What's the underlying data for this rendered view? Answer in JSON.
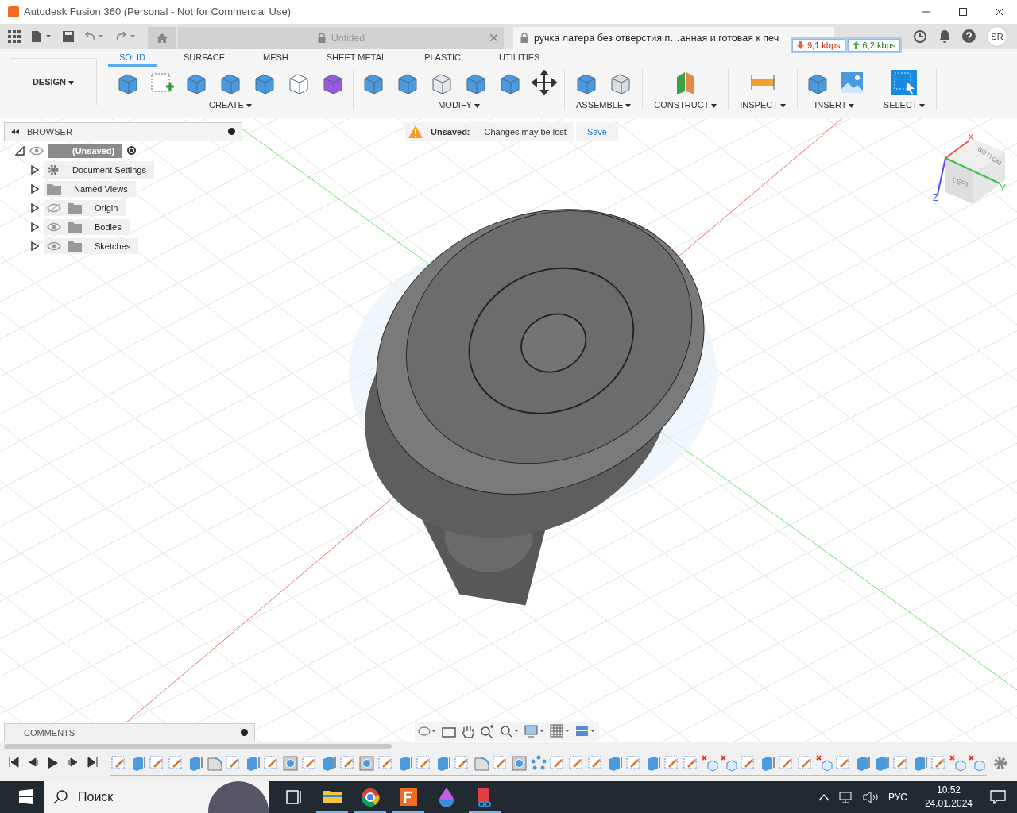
{
  "window": {
    "title": "Autodesk Fusion 360 (Personal - Not for Commercial Use)"
  },
  "doc_tabs": [
    {
      "label": "Untitled",
      "selected": false
    },
    {
      "label": "ручка латера без отверстия п…анная и готовая к печ",
      "selected": true
    }
  ],
  "network": {
    "down": "9,1 kbps",
    "up": "6,2 kbps"
  },
  "user": {
    "initials": "SR"
  },
  "workspace": "DESIGN",
  "toolbar_tabs": [
    {
      "label": "SOLID",
      "selected": true
    },
    {
      "label": "SURFACE",
      "selected": false
    },
    {
      "label": "MESH",
      "selected": false
    },
    {
      "label": "SHEET METAL",
      "selected": false
    },
    {
      "label": "PLASTIC",
      "selected": false
    },
    {
      "label": "UTILITIES",
      "selected": false
    }
  ],
  "tool_groups": [
    {
      "label": "CREATE",
      "tools": [
        {
          "kind": "solid"
        },
        {
          "kind": "sketch"
        },
        {
          "kind": "solid"
        },
        {
          "kind": "solid"
        },
        {
          "kind": "solid"
        },
        {
          "kind": "pattern"
        },
        {
          "kind": "form"
        }
      ]
    },
    {
      "label": "MODIFY",
      "tools": [
        {
          "kind": "solid"
        },
        {
          "kind": "solid"
        },
        {
          "kind": "shell"
        },
        {
          "kind": "solid"
        },
        {
          "kind": "solid"
        },
        {
          "kind": "move"
        }
      ]
    },
    {
      "label": "ASSEMBLE",
      "tools": [
        {
          "kind": "solid"
        },
        {
          "kind": "joint"
        }
      ]
    },
    {
      "label": "CONSTRUCT",
      "tools": [
        {
          "kind": "plane"
        }
      ]
    },
    {
      "label": "INSPECT",
      "tools": [
        {
          "kind": "measure"
        }
      ]
    },
    {
      "label": "INSERT",
      "tools": [
        {
          "kind": "solid"
        },
        {
          "kind": "image"
        }
      ]
    },
    {
      "label": "SELECT",
      "tools": [
        {
          "kind": "select"
        }
      ]
    }
  ],
  "browser": {
    "title": "BROWSER",
    "root": {
      "label": "(Unsaved)",
      "visible": true,
      "active": true
    },
    "items": [
      {
        "label": "Document Settings",
        "kind": "settings"
      },
      {
        "label": "Named Views",
        "kind": "folder"
      },
      {
        "label": "Origin",
        "kind": "folder",
        "visible": false
      },
      {
        "label": "Bodies",
        "kind": "folder",
        "visible": true
      },
      {
        "label": "Sketches",
        "kind": "folder",
        "visible": true
      }
    ]
  },
  "notice": {
    "label": "Unsaved:",
    "message": "Changes may be lost",
    "action": "Save"
  },
  "viewcube": {
    "front": "LEFT",
    "top": "BOTTOM",
    "x": "X",
    "y": "Y",
    "z": "Z"
  },
  "comments": {
    "title": "COMMENTS"
  },
  "timeline": {
    "steps": [
      {
        "kind": "sketch"
      },
      {
        "kind": "extrude"
      },
      {
        "kind": "sketch"
      },
      {
        "kind": "sketch"
      },
      {
        "kind": "extrude"
      },
      {
        "kind": "fillet"
      },
      {
        "kind": "sketch"
      },
      {
        "kind": "extrude"
      },
      {
        "kind": "sketch"
      },
      {
        "kind": "hole"
      },
      {
        "kind": "sketch"
      },
      {
        "kind": "extrude"
      },
      {
        "kind": "sketch"
      },
      {
        "kind": "hole"
      },
      {
        "kind": "sketch"
      },
      {
        "kind": "extrude"
      },
      {
        "kind": "sketch"
      },
      {
        "kind": "extrude"
      },
      {
        "kind": "sketch"
      },
      {
        "kind": "fillet"
      },
      {
        "kind": "sketch"
      },
      {
        "kind": "hole"
      },
      {
        "kind": "pattern"
      },
      {
        "kind": "sketch"
      },
      {
        "kind": "sketch"
      },
      {
        "kind": "sketch"
      },
      {
        "kind": "extrude"
      },
      {
        "kind": "sketch"
      },
      {
        "kind": "extrude"
      },
      {
        "kind": "sketch"
      },
      {
        "kind": "sketch"
      },
      {
        "kind": "delete"
      },
      {
        "kind": "delete"
      },
      {
        "kind": "sketch"
      },
      {
        "kind": "extrude"
      },
      {
        "kind": "sketch"
      },
      {
        "kind": "sketch"
      },
      {
        "kind": "delete"
      },
      {
        "kind": "sketch"
      },
      {
        "kind": "extrude"
      },
      {
        "kind": "extrude"
      },
      {
        "kind": "sketch"
      },
      {
        "kind": "extrude"
      },
      {
        "kind": "sketch"
      },
      {
        "kind": "delete"
      },
      {
        "kind": "delete"
      }
    ]
  },
  "taskbar": {
    "search": "Поиск",
    "language": "РУС",
    "time": "10:52",
    "date": "24.01.2024"
  }
}
